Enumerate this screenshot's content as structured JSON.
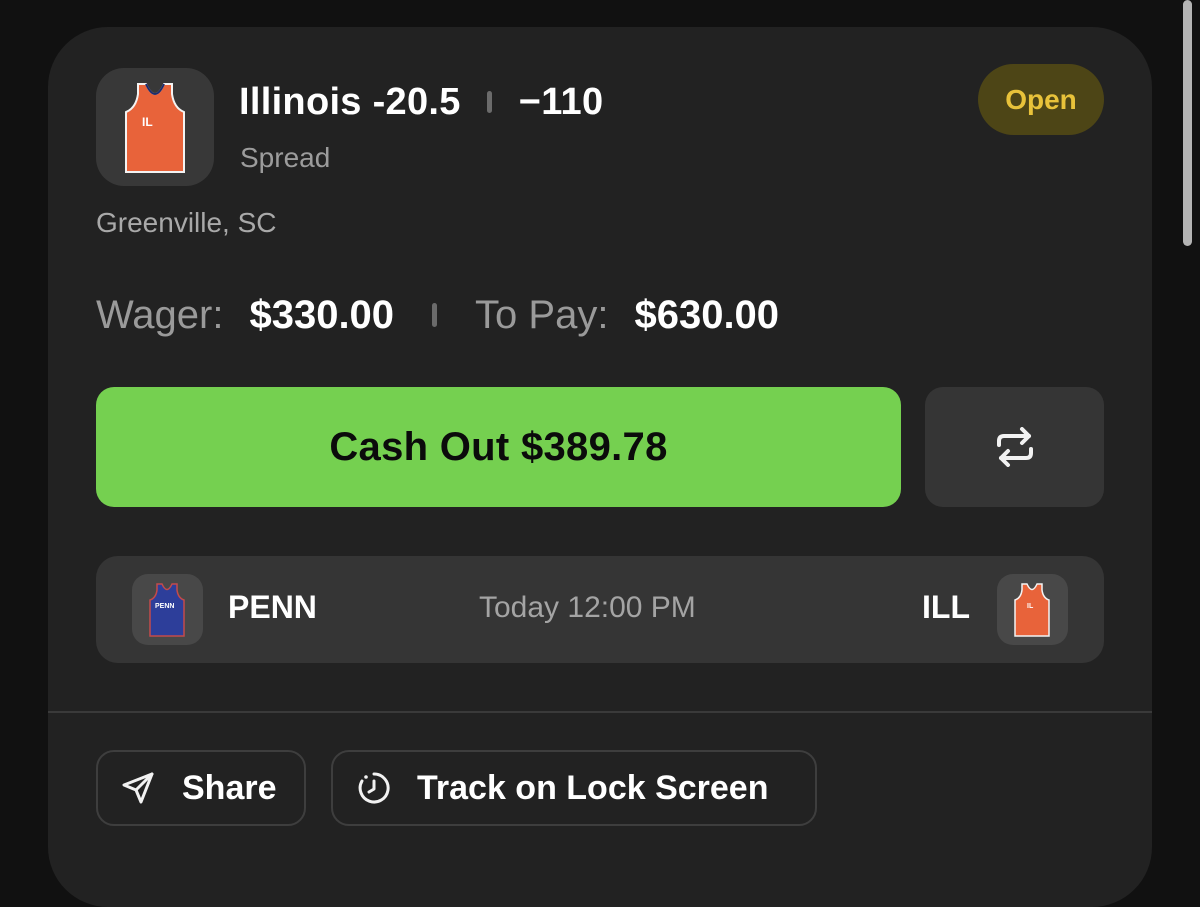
{
  "bet": {
    "team": "Illinois -20.5",
    "odds": "−110",
    "type": "Spread",
    "status": "Open",
    "location": "Greenville, SC",
    "jersey_text": "IL"
  },
  "amounts": {
    "wager_label": "Wager:",
    "wager_value": "$330.00",
    "to_pay_label": "To Pay:",
    "to_pay_value": "$630.00"
  },
  "actions": {
    "cashout_label": "Cash Out $389.78",
    "refresh_icon": "refresh-icon"
  },
  "matchup": {
    "away": {
      "abbr": "PENN",
      "jersey_text": "PENN"
    },
    "time": "Today 12:00 PM",
    "home": {
      "abbr": "ILL",
      "jersey_text": "IL"
    }
  },
  "footer": {
    "share_label": "Share",
    "share_icon": "send-icon",
    "track_label": "Track on Lock Screen",
    "track_icon": "clock-icon"
  },
  "colors": {
    "accent_green": "#75d050",
    "status_yellow": "#e8c23a",
    "illinois_orange": "#e8633a",
    "penn_blue": "#2d3e9a"
  }
}
